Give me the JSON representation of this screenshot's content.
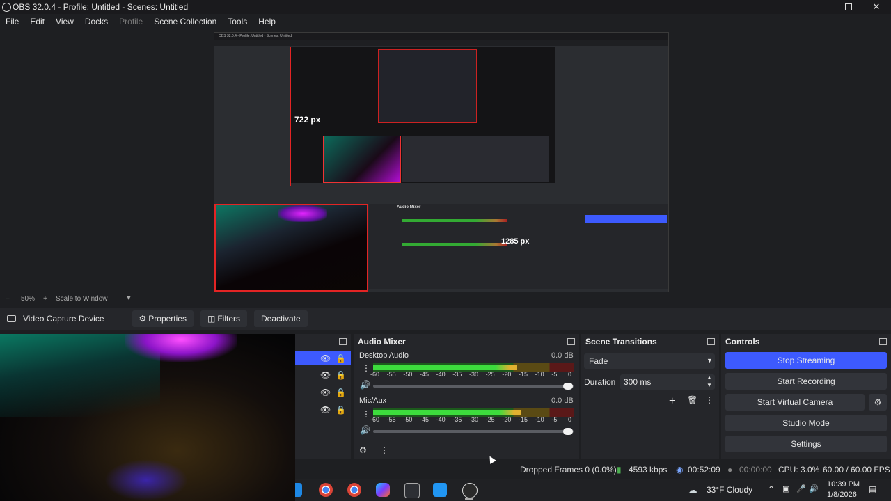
{
  "window": {
    "title": "OBS 32.0.4 - Profile: Untitled - Scenes: Untitled"
  },
  "menu": [
    "File",
    "Edit",
    "View",
    "Docks",
    "Profile",
    "Scene Collection",
    "Tools",
    "Help"
  ],
  "preview": {
    "zoom": "50%",
    "scale_mode": "Scale to Window",
    "nested_title": "OBS 32.0.4 - Profile: Untitled - Scenes: Untitled",
    "label_height": "722 px",
    "label_width": "1285 px"
  },
  "source_toolbar": {
    "source_name": "Video Capture Device",
    "properties": "Properties",
    "filters": "Filters",
    "deactivate": "Deactivate"
  },
  "audio_mixer": {
    "title": "Audio Mixer",
    "channels": [
      {
        "name": "Desktop Audio",
        "db": "0.0 dB",
        "level": 0.72
      },
      {
        "name": "Mic/Aux",
        "db": "0.0 dB",
        "level": 0.74
      }
    ],
    "ticks": [
      "-60",
      "-55",
      "-50",
      "-45",
      "-40",
      "-35",
      "-30",
      "-25",
      "-20",
      "-15",
      "-10",
      "-5",
      "0"
    ]
  },
  "scene_transitions": {
    "title": "Scene Transitions",
    "transition": "Fade",
    "duration_label": "Duration",
    "duration_value": "300 ms"
  },
  "controls": {
    "title": "Controls",
    "stop_streaming": "Stop Streaming",
    "start_recording": "Start Recording",
    "start_virtual_camera": "Start Virtual Camera",
    "studio_mode": "Studio Mode",
    "settings": "Settings",
    "accent": "#3d5afe"
  },
  "status": {
    "dropped_frames": "Dropped Frames 0 (0.0%)",
    "bitrate": "4593 kbps",
    "stream_time": "00:52:09",
    "record_time": "00:00:00",
    "cpu": "CPU: 3.0%",
    "fps": "60.00 / 60.00 FPS"
  },
  "taskbar": {
    "weather": "33°F  Cloudy",
    "time": "10:39 PM",
    "date": "1/8/2026"
  }
}
